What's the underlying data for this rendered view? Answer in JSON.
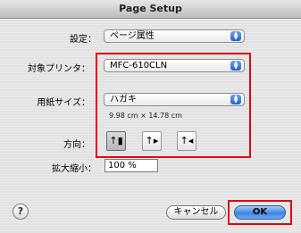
{
  "window": {
    "title": "Page Setup"
  },
  "settings": {
    "label": "設定：",
    "value": "ページ属性"
  },
  "printer": {
    "label": "対象プリンタ：",
    "value": "MFC-610CLN"
  },
  "paper": {
    "label": "用紙サイズ：",
    "value": "ハガキ",
    "dimensions": "9.98 cm × 14.78 cm"
  },
  "orientation": {
    "label": "方向：",
    "options": [
      {
        "name": "portrait",
        "selected": true
      },
      {
        "name": "landscape-left",
        "selected": false
      },
      {
        "name": "landscape-right",
        "selected": false
      }
    ]
  },
  "scale": {
    "label": "拡大縮小：",
    "value": "100 %"
  },
  "buttons": {
    "help": "?",
    "cancel": "キャンセル",
    "ok": "OK"
  },
  "colors": {
    "highlight": "#e0000f",
    "accent": "#3d86e6"
  }
}
